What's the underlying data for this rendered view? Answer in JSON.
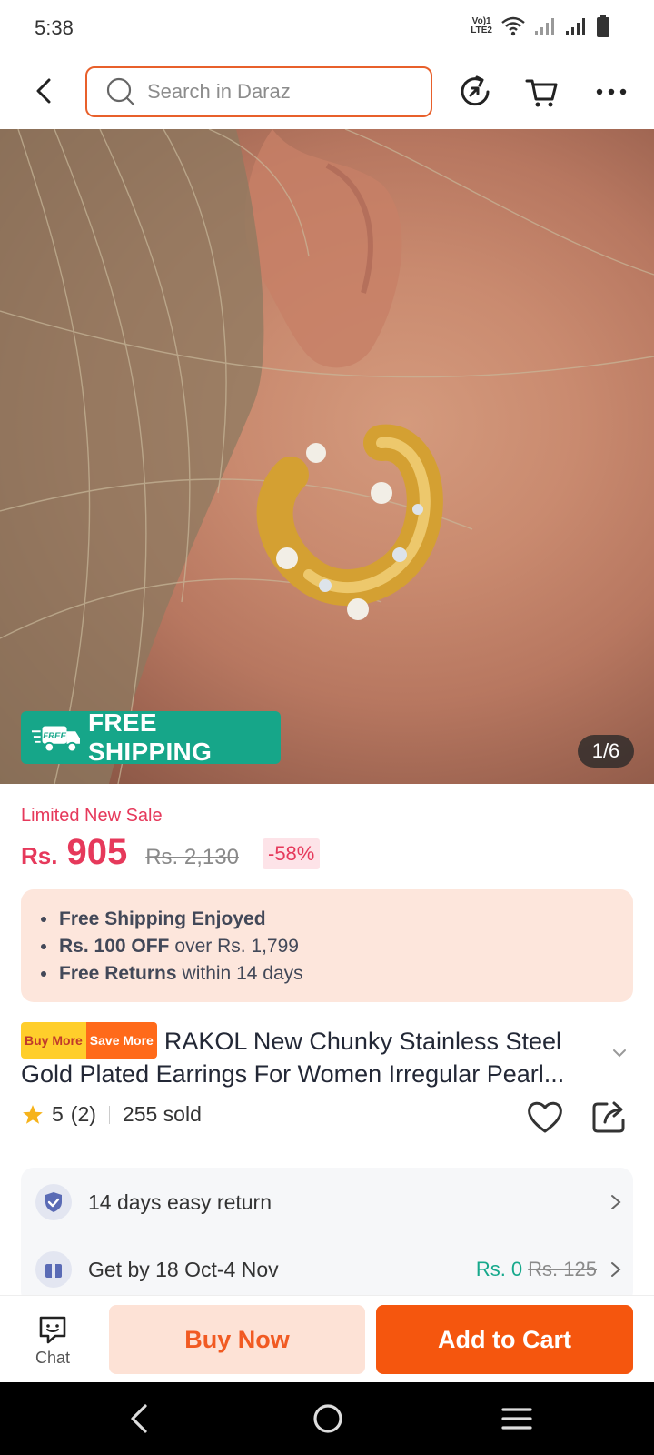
{
  "status_bar": {
    "time": "5:38",
    "network_label": "VoLTE2",
    "icons": [
      "volte-icon",
      "wifi-icon",
      "signal-icon",
      "signal-icon",
      "battery-icon"
    ]
  },
  "top_bar": {
    "search_placeholder": "Search in Daraz",
    "icons": [
      "back-arrow-icon",
      "search-icon",
      "refresh-icon",
      "cart-icon",
      "more-icon"
    ]
  },
  "hero": {
    "badge_label": "FREE SHIPPING",
    "badge_icon_text": "FREE",
    "counter": "1/6"
  },
  "price": {
    "promo_label": "Limited New Sale",
    "currency": "Rs.",
    "current": "905",
    "original": "Rs. 2,130",
    "discount": "-58%"
  },
  "benefits": [
    {
      "bold": "Free Shipping Enjoyed",
      "rest": ""
    },
    {
      "bold": "Rs. 100 OFF",
      "rest": "over Rs. 1,799"
    },
    {
      "bold": "Free Returns",
      "rest": "within 14 days"
    }
  ],
  "product": {
    "tag_buy_more": "Buy More",
    "tag_save_more": "Save More",
    "title_line1": "RAKOL New Chunky Stainless Steel",
    "title_line2": "Gold Plated Earrings For Women Irregular Pearl..."
  },
  "rating": {
    "score": "5",
    "count": "(2)",
    "sold": "255 sold"
  },
  "services": {
    "return_text": "14 days easy return",
    "delivery_text": "Get by 18 Oct-4 Nov",
    "delivery_fee": "Rs. 0",
    "delivery_fee_old": "Rs. 125"
  },
  "actions": {
    "chat_label": "Chat",
    "buy_now": "Buy Now",
    "add_to_cart": "Add to Cart"
  },
  "colors": {
    "accent_orange": "#f5560e",
    "price_red": "#e6395b",
    "free_ship_green": "#16a689"
  }
}
